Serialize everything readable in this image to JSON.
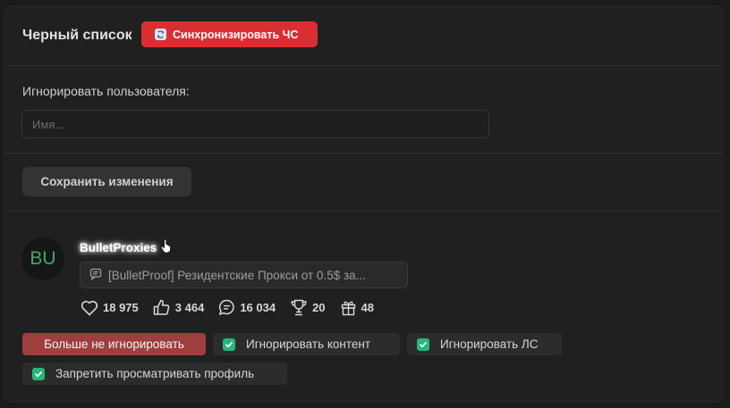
{
  "header": {
    "title": "Черный список",
    "sync_button": "Синхронизировать ЧС"
  },
  "ignore_form": {
    "label": "Игнорировать пользователя:",
    "input_placeholder": "Имя...",
    "input_value": "",
    "save_button": "Сохранить изменения"
  },
  "ignored_user": {
    "avatar_initials": "BU",
    "username": "BulletProxies",
    "thread_title": "[BulletProof] Резидентские Прокси от 0.5$ за...",
    "stats": {
      "likes": "18 975",
      "thumbs": "3 464",
      "messages": "16 034",
      "trophies": "20",
      "gifts": "48"
    },
    "actions": {
      "unignore": "Больше не игнорировать",
      "ignore_content": "Игнорировать контент",
      "ignore_pm": "Игнорировать ЛС",
      "block_profile": "Запретить просматривать профиль"
    }
  },
  "colors": {
    "accent_red": "#d92e32",
    "unignore_bg": "#9f3e3f",
    "check_green": "#27b67a",
    "avatar_text": "#3ea86b"
  }
}
